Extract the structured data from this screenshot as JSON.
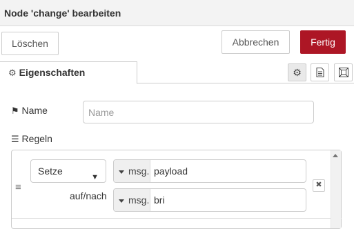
{
  "dialog": {
    "title": "Node 'change' bearbeiten"
  },
  "toolbar": {
    "delete_label": "Löschen",
    "cancel_label": "Abbrechen",
    "done_label": "Fertig"
  },
  "tabs": [
    {
      "label": "Eigenschaften",
      "icon": "gear-icon",
      "active": true
    }
  ],
  "tab_buttons": [
    {
      "icon": "gear-icon",
      "active": true
    },
    {
      "icon": "document-icon",
      "active": false
    },
    {
      "icon": "frame-icon",
      "active": false
    }
  ],
  "form": {
    "name_label": "Name",
    "name_placeholder": "Name",
    "name_value": "",
    "rules_label": "Regeln"
  },
  "rules": [
    {
      "action": "Setze",
      "target": {
        "type": "msg.",
        "value": "payload"
      },
      "to_label": "auf/nach",
      "source": {
        "type": "msg.",
        "value": "bri"
      }
    }
  ],
  "colors": {
    "accent": "#ad1625",
    "header_bg": "#f3f3f3",
    "border": "#cccccc"
  }
}
